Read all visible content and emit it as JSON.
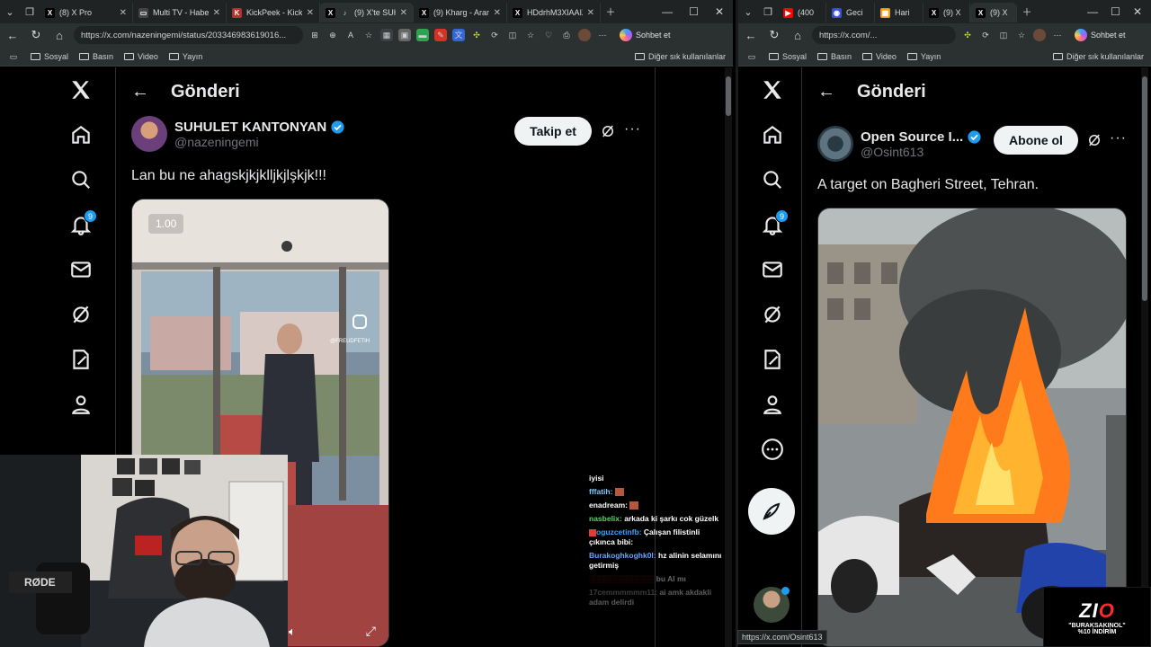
{
  "left_window": {
    "tabs": [
      {
        "label": "(8) X Pro",
        "icon": "x-logo"
      },
      {
        "label": "Multi TV - Haber İz",
        "icon": "tv"
      },
      {
        "label": "KickPeek - Kick.com",
        "icon": "kickpeek"
      },
      {
        "label": "(9) X'te SUHUL",
        "icon": "x-logo",
        "active": true
      },
      {
        "label": "(9) Kharg - Arama",
        "icon": "x-logo"
      },
      {
        "label": "HDdrhM3XlAAIZq",
        "icon": "x-logo"
      }
    ],
    "url": "https://x.com/nazeningemi/status/203346983619016...",
    "chat_button": "Sohbet et",
    "bookmarks": [
      "Sosyal",
      "Basın",
      "Video",
      "Yayın"
    ],
    "bookmarks_right": "Diğer sık kullanılanlar",
    "notif_count": "9",
    "header_title": "Gönderi",
    "author_name": "SUHULET KANTONYAN",
    "author_handle": "@nazeningemi",
    "follow_label": "Takip et",
    "tweet_text": "Lan bu ne ahagskjkjklljkjlşkjk!!!",
    "video_speed": "1.00",
    "video_watermark": "@FREUDFETIH"
  },
  "chat": [
    {
      "user": "",
      "text": "iyisi",
      "color": "#ffffff"
    },
    {
      "user": "fffatih:",
      "text": "",
      "color": "#7ec8ff"
    },
    {
      "user": "enadream:",
      "text": "",
      "color": "#ffffff"
    },
    {
      "user": "nasbelix:",
      "text": "arkada ki şarkı cok güzelk",
      "color": "#55d66b"
    },
    {
      "user": "oguzcetinfb:",
      "text": "Çalışan filistinli çıkınca bibi:",
      "color": "#3aa0ff"
    },
    {
      "user": "Burakoghkoghk0l:",
      "text": "hz alinin selamını getirmiş",
      "color": "#6aa5ff"
    },
    {
      "user": "",
      "text": "bu AI mı",
      "color": "#8a8a8a"
    },
    {
      "user": "17cemmmmmm11:",
      "text": "ai amk akdakli adam delirdi",
      "color": "#8a8a8a"
    }
  ],
  "right_window": {
    "tabs": [
      {
        "label": "(400",
        "icon": "youtube"
      },
      {
        "label": "Geci",
        "icon": "globe"
      },
      {
        "label": "Hari",
        "icon": "map"
      },
      {
        "label": "(9) X",
        "icon": "x-logo"
      },
      {
        "label": "(9) X",
        "icon": "x-logo",
        "active": true
      }
    ],
    "url": "https://x.com/...",
    "chat_button": "Sohbet et",
    "bookmarks": [
      "Sosyal",
      "Basın",
      "Video",
      "Yayın"
    ],
    "bookmarks_right": "Diğer sık kullanılanlar",
    "notif_count": "9",
    "header_title": "Gönderi",
    "author_name": "Open Source I...",
    "author_handle": "@Osint613",
    "subscribe_label": "Abone ol",
    "tweet_text": "A target on Bagheri Street, Tehran.",
    "status_url": "https://x.com/Osint613"
  },
  "promo": {
    "logo_main": "ZI",
    "logo_accent": "O",
    "line1": "\"BURAKSAKINOL\"",
    "line2": "%10 İNDİRİM"
  },
  "colors": {
    "accent": "#1d9bf0",
    "background": "#000000",
    "text": "#e7e9ea",
    "muted": "#71767b"
  }
}
